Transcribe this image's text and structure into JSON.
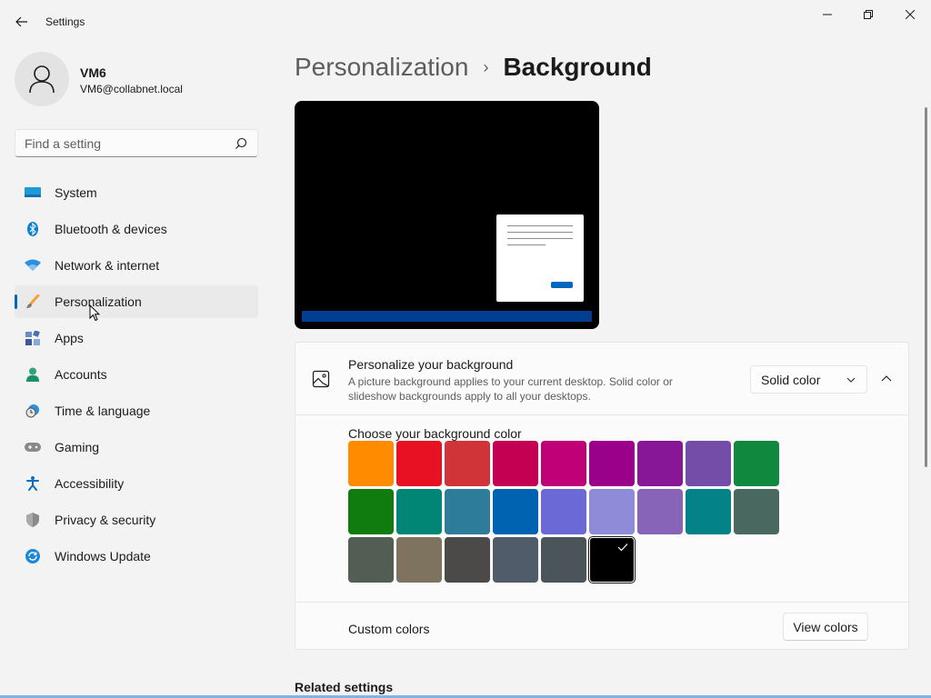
{
  "window": {
    "title": "Settings",
    "back_icon": "back-arrow-icon",
    "minimize_icon": "minimize-icon",
    "maximize_icon": "restore-icon",
    "close_icon": "close-icon"
  },
  "profile": {
    "name": "VM6",
    "email": "VM6@collabnet.local",
    "avatar_icon": "person-icon"
  },
  "search": {
    "placeholder": "Find a setting",
    "icon": "search-icon"
  },
  "sidebar": {
    "items": [
      {
        "label": "System",
        "icon": "system-monitor-icon",
        "active": false
      },
      {
        "label": "Bluetooth & devices",
        "icon": "bluetooth-icon",
        "active": false
      },
      {
        "label": "Network & internet",
        "icon": "wifi-icon",
        "active": false
      },
      {
        "label": "Personalization",
        "icon": "paintbrush-icon",
        "active": true
      },
      {
        "label": "Apps",
        "icon": "apps-icon",
        "active": false
      },
      {
        "label": "Accounts",
        "icon": "accounts-icon",
        "active": false
      },
      {
        "label": "Time & language",
        "icon": "clock-globe-icon",
        "active": false
      },
      {
        "label": "Gaming",
        "icon": "gamepad-icon",
        "active": false
      },
      {
        "label": "Accessibility",
        "icon": "accessibility-icon",
        "active": false
      },
      {
        "label": "Privacy & security",
        "icon": "shield-icon",
        "active": false
      },
      {
        "label": "Windows Update",
        "icon": "update-icon",
        "active": false
      }
    ]
  },
  "header": {
    "parent": "Personalization",
    "separator": "›",
    "current": "Background"
  },
  "background_card": {
    "title": "Personalize your background",
    "description": "A picture background applies to your current desktop. Solid color or slideshow backgrounds apply to all your desktops.",
    "icon": "picture-icon",
    "dropdown_value": "Solid color",
    "collapse_icon": "chevron-up-icon",
    "swatch_label": "Choose your background color",
    "colors": [
      "#FF8C00",
      "#E81123",
      "#D13438",
      "#C30052",
      "#BF0077",
      "#9A0089",
      "#881798",
      "#744DA9",
      "#10893E",
      "#107C10",
      "#018574",
      "#2D7D9A",
      "#0063B1",
      "#6B69D6",
      "#8E8CD8",
      "#8764B8",
      "#038387",
      "#486860",
      "#525E54",
      "#7E735F",
      "#4C4A48",
      "#515C6B",
      "#4A5459",
      "#000000"
    ],
    "selected_color": "#000000",
    "custom_colors_label": "Custom colors",
    "view_colors_label": "View colors"
  },
  "related_settings": {
    "title": "Related settings"
  },
  "accent_color": "#0067C0"
}
